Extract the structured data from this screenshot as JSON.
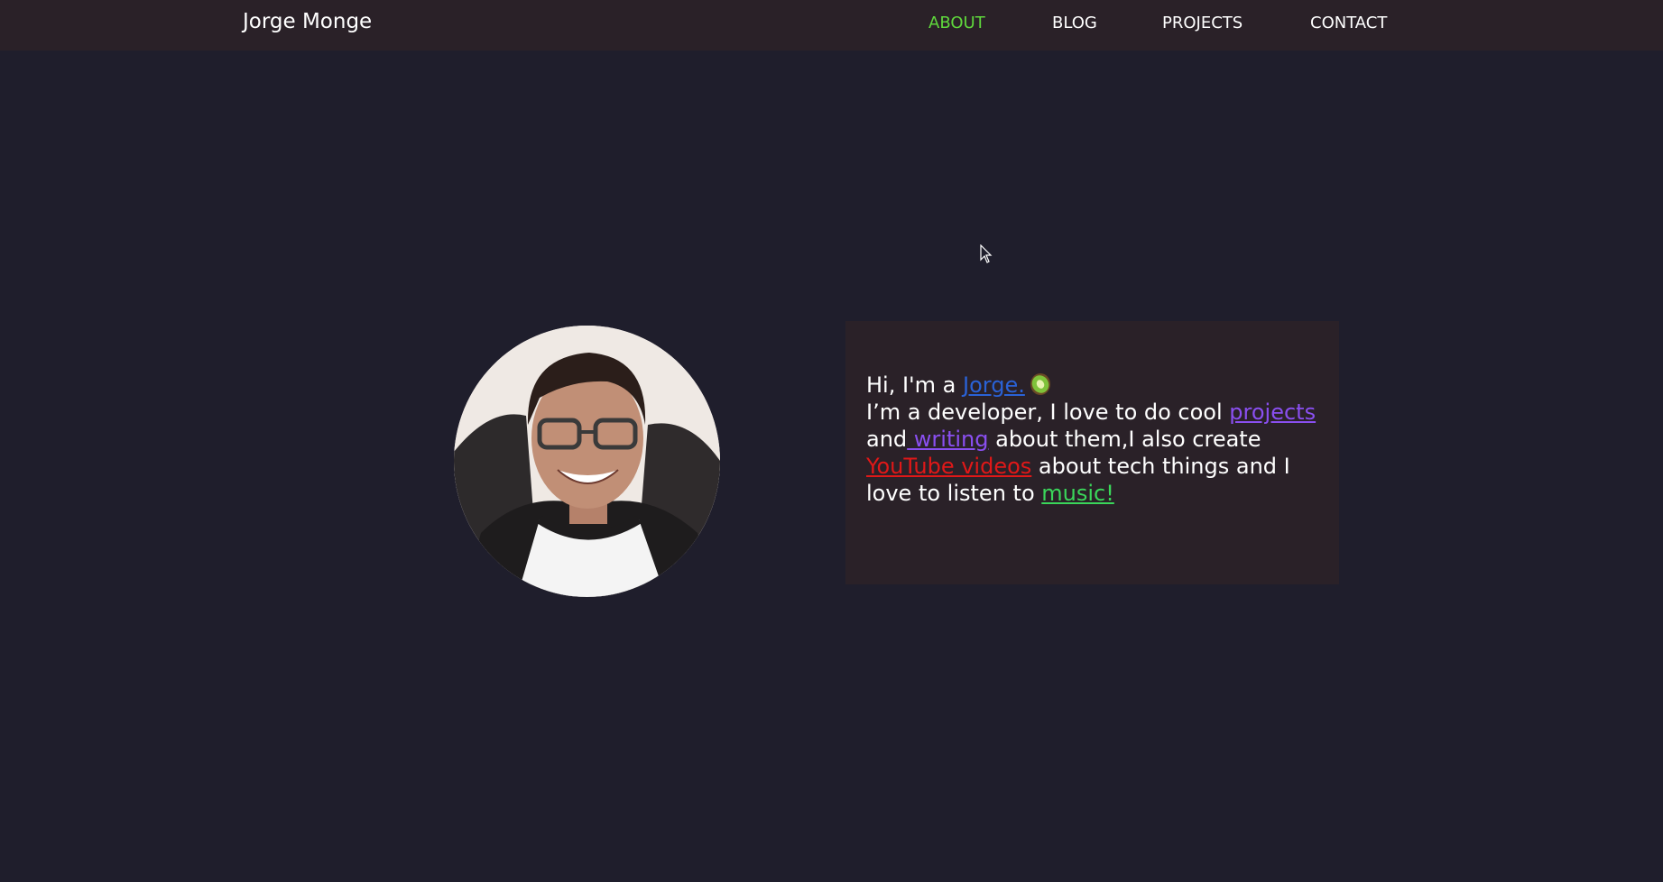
{
  "header": {
    "brand": "Jorge Monge",
    "nav": [
      {
        "label": "ABOUT",
        "active": true
      },
      {
        "label": "BLOG",
        "active": false
      },
      {
        "label": "PROJECTS",
        "active": false
      },
      {
        "label": "CONTACT",
        "active": false
      }
    ]
  },
  "intro": {
    "greeting": "Hi, I'm a ",
    "name_link": "Jorge.",
    "kiwi_icon": "kiwi-icon",
    "line2_pre": "I’m a developer, I love to do cool ",
    "projects_link": "projects",
    "and_text": "and",
    "writing_link": " writing",
    "line3_mid": " about them,I also create ",
    "youtube_link": "YouTube videos",
    "line4_mid": " about tech things and I love to listen to ",
    "music_link": "music!"
  },
  "colors": {
    "background": "#1f1e2c",
    "navbar": "#2a2128",
    "card": "#2a2128",
    "active_nav": "#5fd73c",
    "name_link": "#2a62d6",
    "projects_link": "#8a4ff0",
    "youtube_link": "#e01818",
    "music_link": "#3ad65a"
  }
}
